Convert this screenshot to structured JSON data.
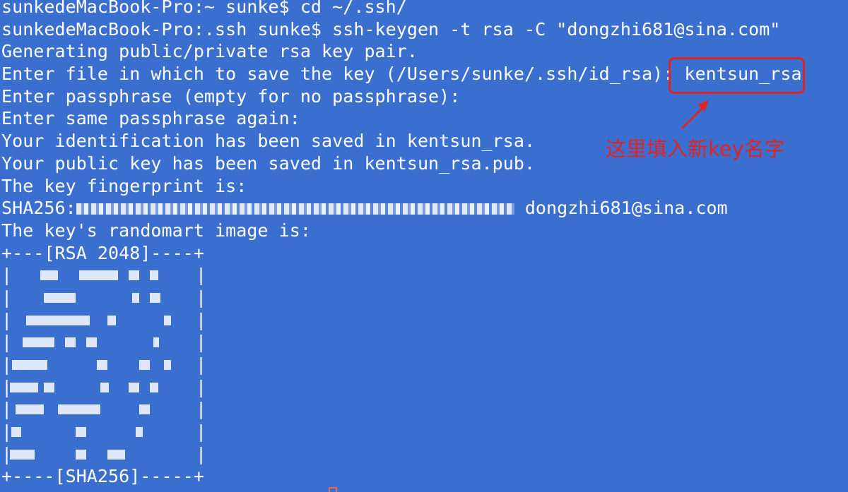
{
  "terminal": {
    "lines": [
      "sunkedeMacBook-Pro:~ sunke$ cd ~/.ssh/",
      "sunkedeMacBook-Pro:.ssh sunke$ ssh-keygen -t rsa -C \"dongzhi681@sina.com\"",
      "Generating public/private rsa key pair.",
      "Enter file in which to save the key (/Users/sunke/.ssh/id_rsa): kentsun_rsa",
      "Enter passphrase (empty for no passphrase):",
      "Enter same passphrase again:",
      "Your identification has been saved in kentsun_rsa.",
      "Your public key has been saved in kentsun_rsa.pub.",
      "The key fingerprint is:"
    ],
    "fingerprint_prefix": "SHA256:",
    "fingerprint_email": " dongzhi681@sina.com",
    "randomart_intro": "The key's randomart image is:",
    "randomart_header": "+---[RSA 2048]----+",
    "randomart_footer": "+----[SHA256]-----+"
  },
  "annotation": {
    "text": "这里填入新key名字",
    "color": "#e02424"
  },
  "colors": {
    "background": "#3a6fcf",
    "text": "#ffffff",
    "highlight": "#e02424"
  }
}
